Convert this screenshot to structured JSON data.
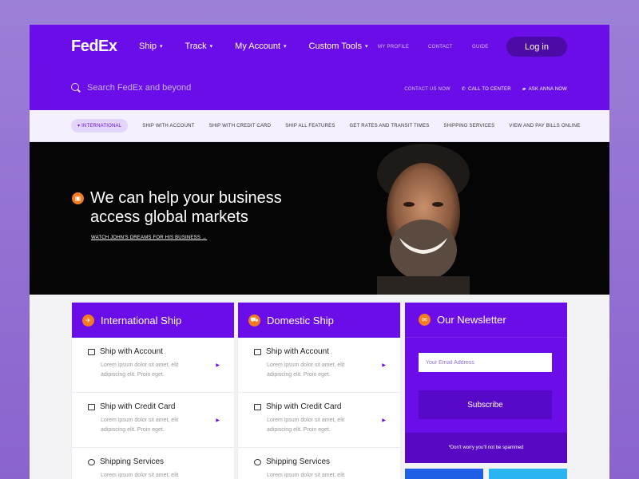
{
  "colors": {
    "brand": "#6b0de8",
    "accent": "#f47b20",
    "dark": "#4c0aa6"
  },
  "header": {
    "logo": "FedEx",
    "nav": [
      {
        "label": "Ship"
      },
      {
        "label": "Track"
      },
      {
        "label": "My Account"
      },
      {
        "label": "Custom Tools"
      }
    ],
    "links": {
      "profile": "MY PROFILE",
      "contact": "CONTACT",
      "guide": "GUIDE"
    },
    "login": "Log in",
    "search_placeholder": "Search FedEx and beyond",
    "contact_us": "CONTACT US NOW",
    "call_center": "CALL TO CENTER",
    "ask_anna": "ASK ANNA NOW"
  },
  "subnav": [
    "INTERNATIONAL",
    "SHIP WITH ACCOUNT",
    "SHIP WITH CREDIT CARD",
    "SHIP ALL FEATURES",
    "GET RATES AND TRANSIT TIMES",
    "SHIPPING SERVICES",
    "VIEW AND PAY BILLS ONLINE"
  ],
  "hero": {
    "title": "We can help your business access global markets",
    "link": "WATCH JOHN'S DREAMS FOR HIS BUSINESS"
  },
  "cards": [
    {
      "title": "International Ship",
      "items": [
        {
          "title": "Ship with Account",
          "desc": "Lorem ipsum dolor sit amet, elit adipiscing elit. Proin eget."
        },
        {
          "title": "Ship with Credit Card",
          "desc": "Lorem ipsum dolor sit amet, elit adipiscing elit. Proin eget."
        },
        {
          "title": "Shipping Services",
          "desc": "Lorem ipsum dolor sit amet, elit"
        }
      ]
    },
    {
      "title": "Domestic Ship",
      "items": [
        {
          "title": "Ship with Account",
          "desc": "Lorem ipsum dolor sit amet, elit adipiscing elit. Proin eget."
        },
        {
          "title": "Ship with Credit Card",
          "desc": "Lorem ipsum dolor sit amet, elit adipiscing elit. Proin eget."
        },
        {
          "title": "Shipping Services",
          "desc": "Lorem ipsum dolor sit amet, elit"
        }
      ]
    }
  ],
  "newsletter": {
    "title": "Our Newsletter",
    "placeholder": "Your Email Address",
    "button": "Subscribe",
    "note": "*Don't worry you'll not be spammed"
  }
}
